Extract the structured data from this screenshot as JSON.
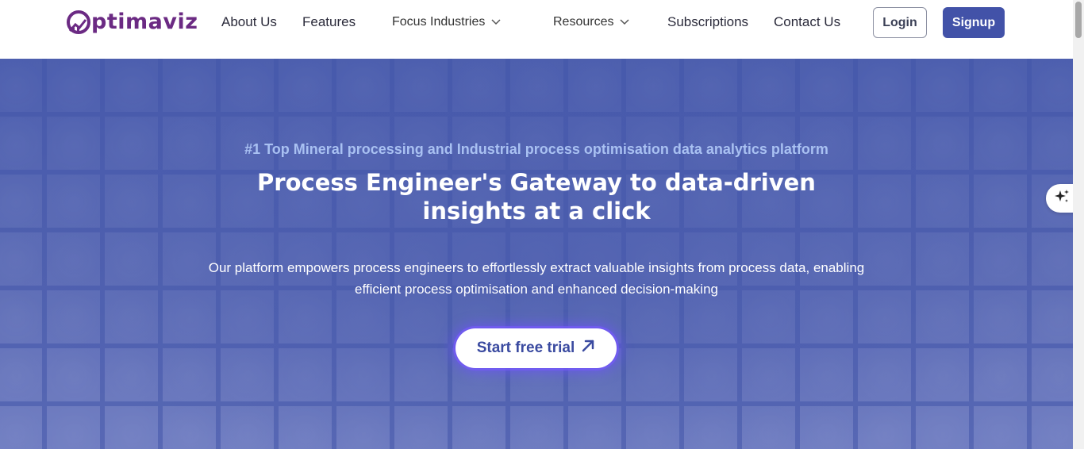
{
  "header": {
    "logo_text": "ptimaviz",
    "nav": {
      "about": "About Us",
      "features": "Features",
      "focus_industries": "Focus Industries",
      "resources": "Resources",
      "subscriptions": "Subscriptions",
      "contact": "Contact Us"
    },
    "login_label": "Login",
    "signup_label": "Signup"
  },
  "hero": {
    "tagline": "#1 Top Mineral processing and Industrial process optimisation data analytics platform",
    "headline_line1": "Process Engineer's Gateway to data-driven",
    "headline_line2": "insights at a click",
    "subtext_line1": "Our platform empowers process engineers to effortlessly extract valuable insights from process data, enabling",
    "subtext_line2": "efficient process optimisation and enhanced decision-making",
    "cta_label": "Start free trial"
  },
  "icons": {
    "logo": "optimaviz-logo-icon",
    "chevron": "chevron-down-icon",
    "cta_arrow": "arrow-up-right-icon",
    "sparkle": "sparkle-icon"
  },
  "colors": {
    "brand": "#6b2a83",
    "hero_bg": "#4356aa",
    "signup_bg": "#4252a8",
    "tagline": "#a9c1f2"
  }
}
